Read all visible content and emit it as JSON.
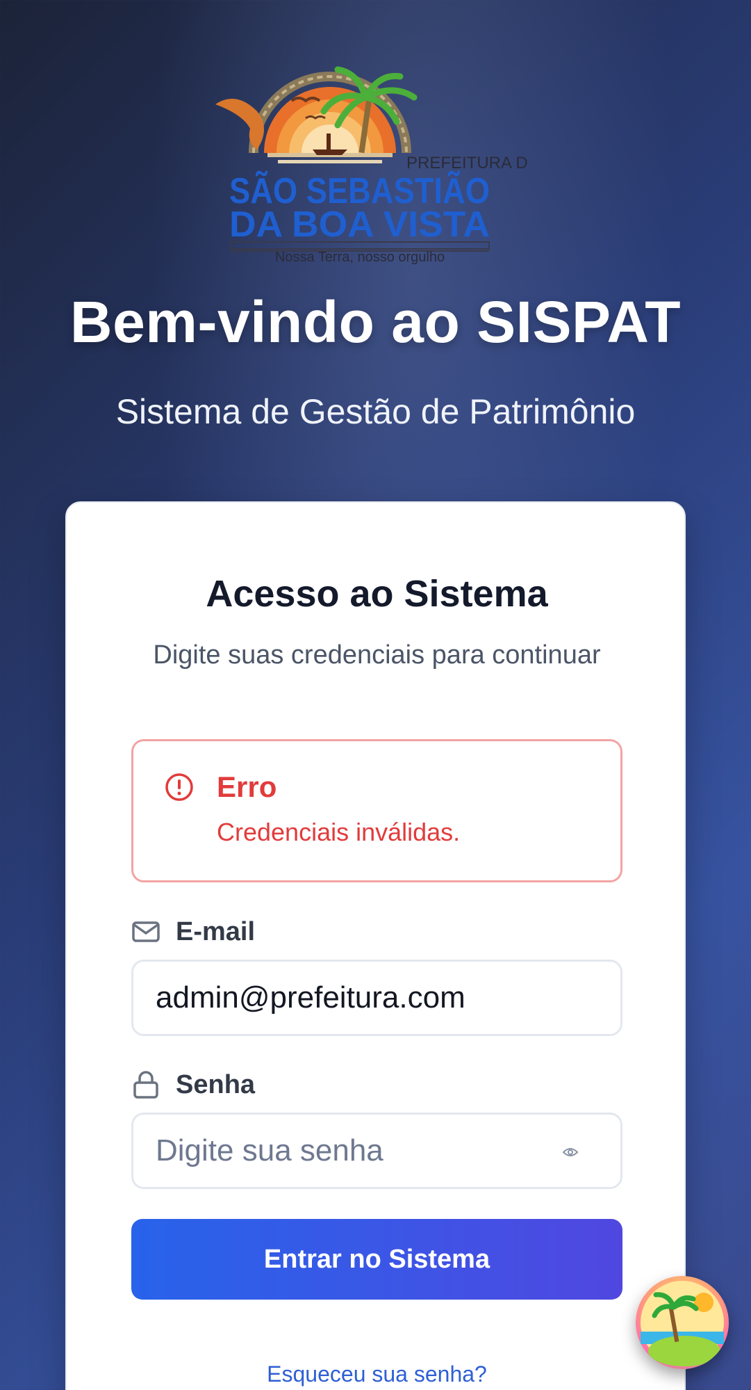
{
  "logo": {
    "prefix": "PREFEITURA DE",
    "name_line1": "SÃO SEBASTIÃO",
    "name_line2": "DA BOA VISTA",
    "slogan": "Nossa Terra, nosso orgulho"
  },
  "header": {
    "title": "Bem-vindo ao SISPAT",
    "subtitle": "Sistema de Gestão de Patrimônio"
  },
  "card": {
    "title": "Acesso ao Sistema",
    "subtitle": "Digite suas credenciais para continuar"
  },
  "alert": {
    "title": "Erro",
    "message": "Credenciais inválidas.",
    "color": "#e23b3b"
  },
  "form": {
    "email_label": "E-mail",
    "email_value": "admin@prefeitura.com",
    "password_label": "Senha",
    "password_placeholder": "Digite sua senha",
    "submit_label": "Entrar no Sistema",
    "forgot_label": "Esqueceu sua senha?"
  },
  "icons": {
    "alert": "alert-circle-icon",
    "email": "mail-icon",
    "password": "lock-icon",
    "toggle": "eye-icon",
    "fab": "tropical-island-icon"
  },
  "colors": {
    "accent": "#2863ea",
    "accent_end": "#5047e0",
    "error": "#e23b3b",
    "link": "#2f5fd6"
  }
}
